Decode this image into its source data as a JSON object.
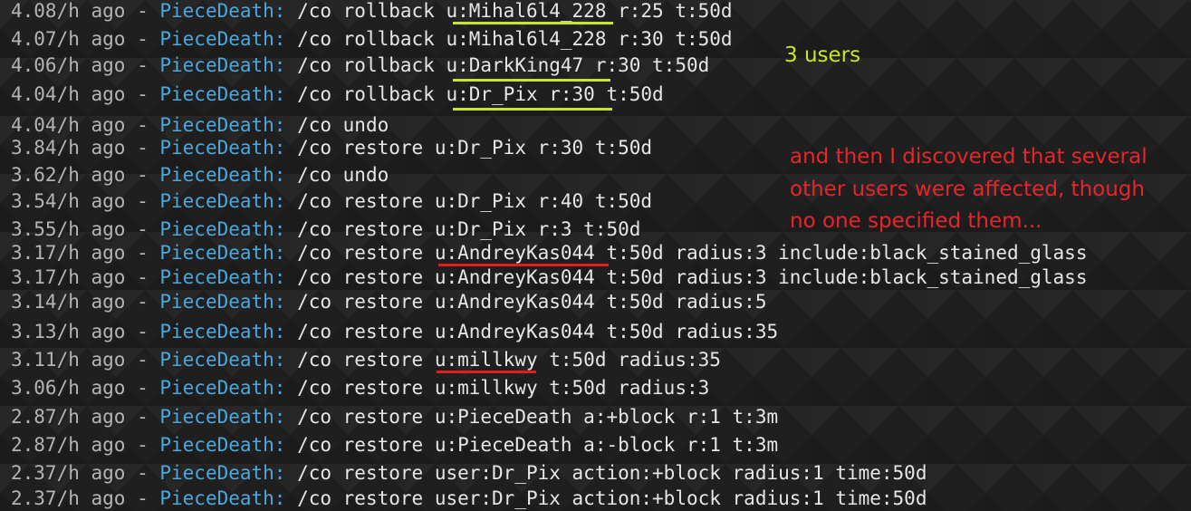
{
  "log": [
    {
      "time": "4.08/h ago - ",
      "player": "PieceDeath:",
      "cmd": " /co rollback u:Mihal6l4_228 r:25 t:50d"
    },
    {
      "time": "4.07/h ago - ",
      "player": "PieceDeath:",
      "cmd": " /co rollback u:Mihal6l4_228 r:30 t:50d"
    },
    {
      "time": "4.06/h ago - ",
      "player": "PieceDeath:",
      "cmd": " /co rollback u:DarkKing47 r:30 t:50d"
    },
    {
      "time": "4.04/h ago - ",
      "player": "PieceDeath:",
      "cmd": " /co rollback u:Dr_Pix r:30 t:50d"
    },
    {
      "time": "4.04/h ago - ",
      "player": "PieceDeath:",
      "cmd": " /co undo"
    },
    {
      "time": "3.84/h ago - ",
      "player": "PieceDeath:",
      "cmd": " /co restore u:Dr_Pix r:30 t:50d"
    },
    {
      "time": "3.62/h ago - ",
      "player": "PieceDeath:",
      "cmd": " /co undo"
    },
    {
      "time": "3.54/h ago - ",
      "player": "PieceDeath:",
      "cmd": " /co restore u:Dr_Pix r:40 t:50d"
    },
    {
      "time": "3.55/h ago - ",
      "player": "PieceDeath:",
      "cmd": " /co restore u:Dr_Pix r:3 t:50d"
    },
    {
      "time": "3.17/h ago - ",
      "player": "PieceDeath:",
      "cmd": " /co restore u:AndreyKas044 t:50d radius:3 include:black_stained_glass"
    },
    {
      "time": "3.17/h ago - ",
      "player": "PieceDeath:",
      "cmd": " /co restore u:AndreyKas044 t:50d radius:3 include:black_stained_glass"
    },
    {
      "time": "3.14/h ago - ",
      "player": "PieceDeath:",
      "cmd": " /co restore u:AndreyKas044 t:50d radius:5"
    },
    {
      "time": "3.13/h ago - ",
      "player": "PieceDeath:",
      "cmd": " /co restore u:AndreyKas044 t:50d radius:35"
    },
    {
      "time": "3.11/h ago - ",
      "player": "PieceDeath:",
      "cmd": " /co restore u:millkwy t:50d radius:35"
    },
    {
      "time": "3.06/h ago - ",
      "player": "PieceDeath:",
      "cmd": " /co restore u:millkwy t:50d radius:3"
    },
    {
      "time": "2.87/h ago - ",
      "player": "PieceDeath:",
      "cmd": " /co restore u:PieceDeath a:+block r:1 t:3m"
    },
    {
      "time": "2.87/h ago - ",
      "player": "PieceDeath:",
      "cmd": " /co restore u:PieceDeath a:-block r:1 t:3m"
    },
    {
      "time": "2.37/h ago - ",
      "player": "PieceDeath:",
      "cmd": " /co restore user:Dr_Pix action:+block radius:1 time:50d"
    },
    {
      "time": "2.37/h ago - ",
      "player": "PieceDeath:",
      "cmd": " /co restore user:Dr_Pix action:+block radius:1 time:50d"
    }
  ],
  "annotations": {
    "users_note": "3 users",
    "discovery_note": [
      "and then I discovered that several",
      "other users were affected, though",
      "no one specified them..."
    ],
    "colors": {
      "yellow": "#c9e52a",
      "red": "#e5262b"
    }
  }
}
